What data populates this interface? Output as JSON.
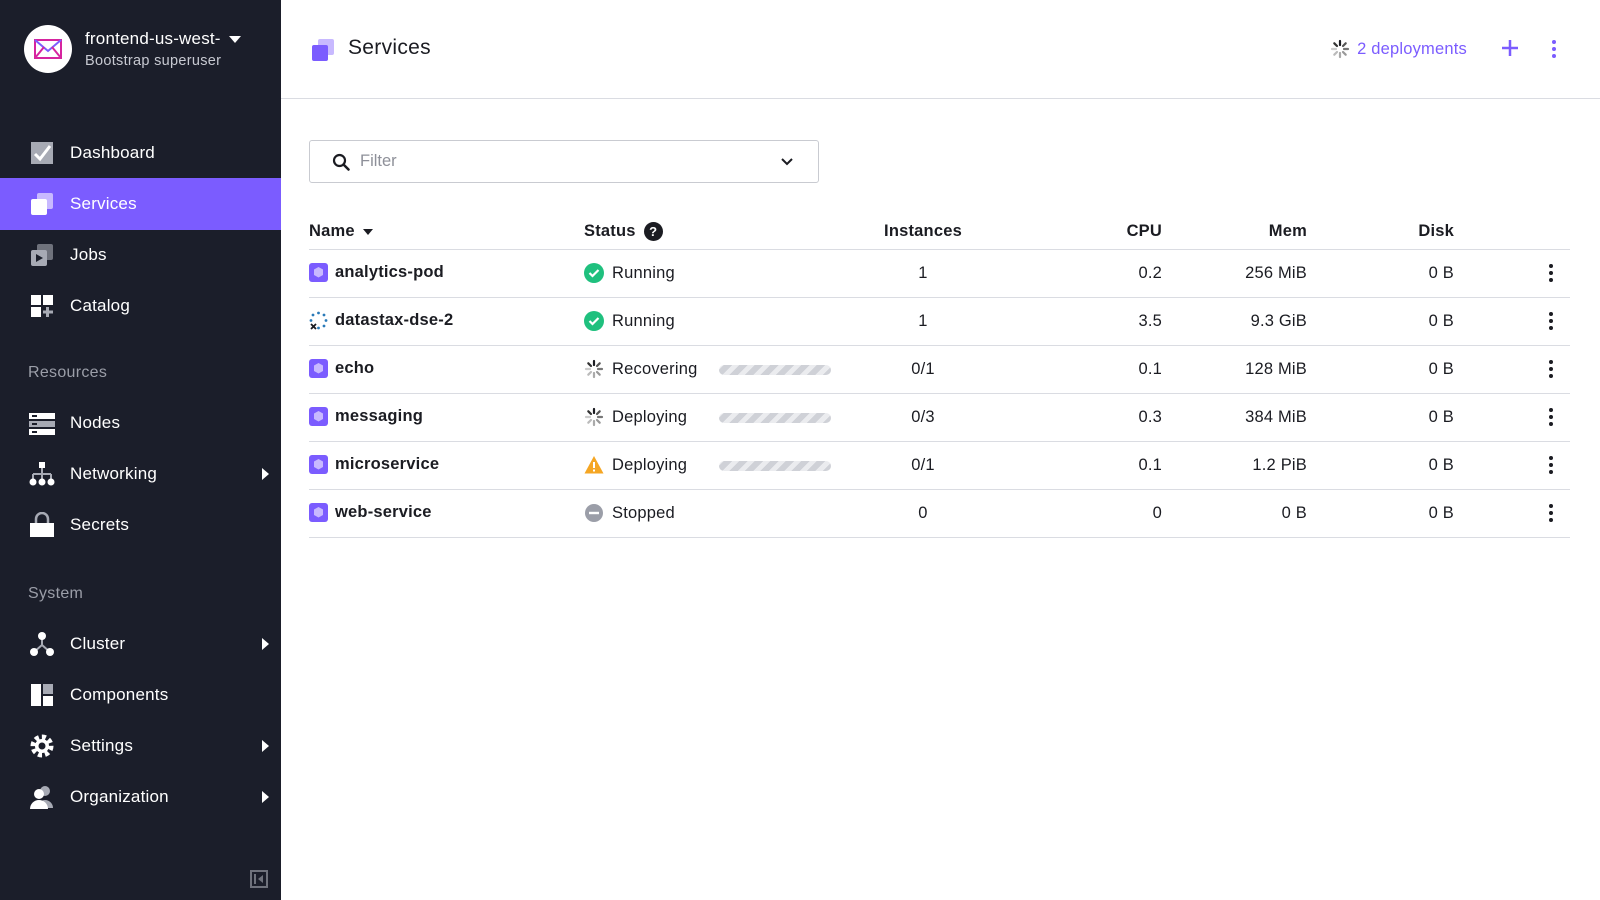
{
  "sidebar": {
    "cluster_name": "frontend-us-west-",
    "cluster_role": "Bootstrap superuser",
    "items": [
      {
        "label": "Dashboard"
      },
      {
        "label": "Services"
      },
      {
        "label": "Jobs"
      },
      {
        "label": "Catalog"
      },
      {
        "label": "Nodes"
      },
      {
        "label": "Networking"
      },
      {
        "label": "Secrets"
      },
      {
        "label": "Cluster"
      },
      {
        "label": "Components"
      },
      {
        "label": "Settings"
      },
      {
        "label": "Organization"
      }
    ],
    "sections": {
      "resources": "Resources",
      "system": "System"
    },
    "active_color": "#7b5cff",
    "background_color": "#1b1e2a"
  },
  "header": {
    "title": "Services",
    "deployments_label": "2 deployments"
  },
  "filter": {
    "placeholder": "Filter",
    "value": ""
  },
  "table": {
    "columns": {
      "name": "Name",
      "status": "Status",
      "instances": "Instances",
      "cpu": "CPU",
      "mem": "Mem",
      "disk": "Disk"
    },
    "rows": [
      {
        "name": "analytics-pod",
        "status": "Running",
        "status_kind": "running",
        "instances": "1",
        "cpu": "0.2",
        "mem": "256 MiB",
        "disk": "0 B"
      },
      {
        "name": "datastax-dse-2",
        "status": "Running",
        "status_kind": "running",
        "instances": "1",
        "cpu": "3.5",
        "mem": "9.3 GiB",
        "disk": "0 B"
      },
      {
        "name": "echo",
        "status": "Recovering",
        "status_kind": "deploying",
        "instances": "0/1",
        "cpu": "0.1",
        "mem": "128 MiB",
        "disk": "0 B"
      },
      {
        "name": "messaging",
        "status": "Deploying",
        "status_kind": "deploying",
        "instances": "0/3",
        "cpu": "0.3",
        "mem": "384 MiB",
        "disk": "0 B"
      },
      {
        "name": "microservice",
        "status": "Deploying",
        "status_kind": "warning",
        "instances": "0/1",
        "cpu": "0.1",
        "mem": "1.2 PiB",
        "disk": "0 B"
      },
      {
        "name": "web-service",
        "status": "Stopped",
        "status_kind": "stopped",
        "instances": "0",
        "cpu": "0",
        "mem": "0 B",
        "disk": "0 B"
      }
    ]
  },
  "colors": {
    "accent": "#7b5cff",
    "running": "#1fc07e",
    "warning": "#f5a623",
    "stopped": "#9b9ea8"
  }
}
